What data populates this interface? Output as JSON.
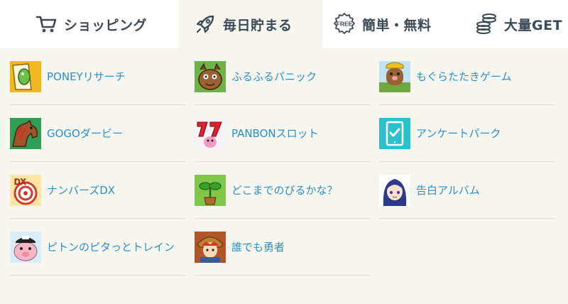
{
  "tabs": [
    {
      "label": "ショッピング",
      "icon": "cart-icon"
    },
    {
      "label": "毎日貯まる",
      "icon": "rocket-icon",
      "active": true
    },
    {
      "label": "簡単・無料",
      "icon": "free-badge-icon",
      "badge": "FREE"
    },
    {
      "label": "大量GET",
      "icon": "coins-icon"
    }
  ],
  "games": [
    {
      "label": "PONEYリサーチ",
      "icon": "poney-research-icon"
    },
    {
      "label": "ふるふるパニック",
      "icon": "furufuru-panic-icon"
    },
    {
      "label": "もぐらたたきゲーム",
      "icon": "mole-whack-icon"
    },
    {
      "label": "GOGOダービー",
      "icon": "horse-derby-icon"
    },
    {
      "label": "PANBONスロット",
      "icon": "slot-seven-icon"
    },
    {
      "label": "アンケートパーク",
      "icon": "survey-tablet-icon"
    },
    {
      "label": "ナンバーズDX",
      "icon": "numbers-dx-target-icon",
      "badge": "DX"
    },
    {
      "label": "どこまでのびるかな？",
      "icon": "sprout-icon"
    },
    {
      "label": "告白アルバム",
      "icon": "anime-girl-icon"
    },
    {
      "label": "ピトンのピタっとトレイン",
      "icon": "pig-conductor-icon"
    },
    {
      "label": "誰でも勇者",
      "icon": "hero-warrior-icon"
    }
  ]
}
